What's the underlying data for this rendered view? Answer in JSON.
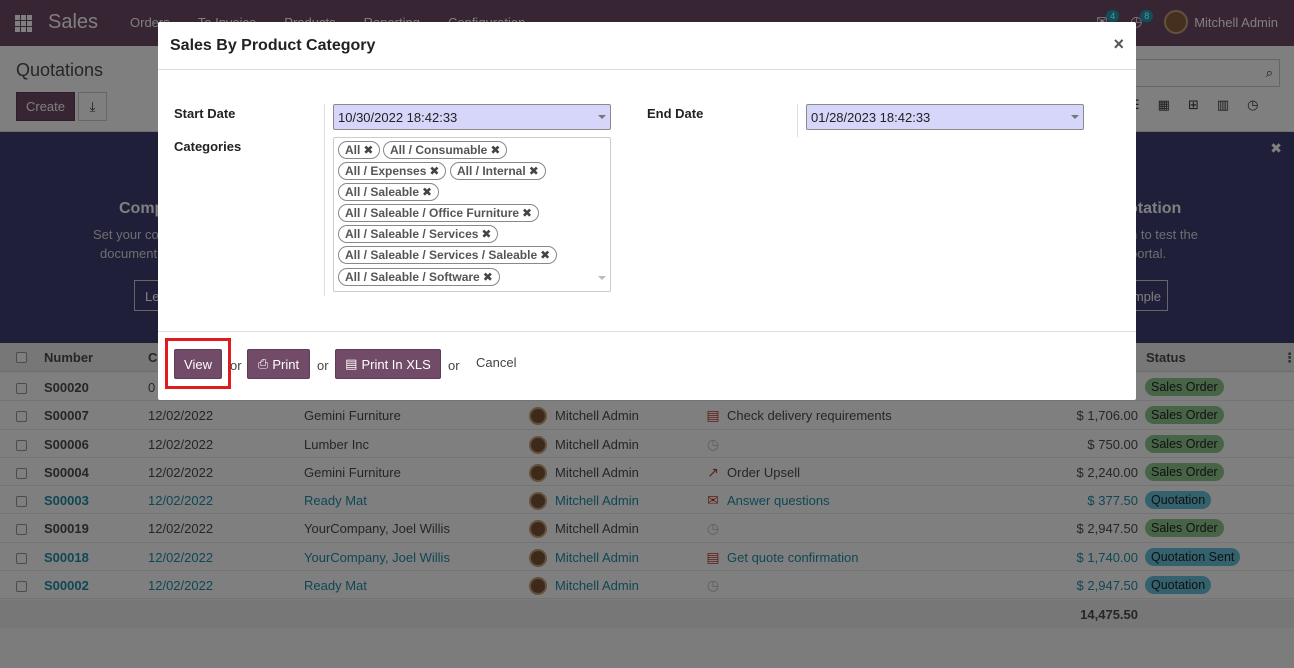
{
  "navbar": {
    "brand": "Sales",
    "menu": [
      "Orders",
      "To Invoice",
      "Products",
      "Reporting",
      "Configuration"
    ],
    "messages_count": "4",
    "activities_count": "8",
    "user_name": "Mitchell Admin"
  },
  "control_panel": {
    "title": "Quotations",
    "create_label": "Create"
  },
  "banner": {
    "left_title": "Comp",
    "left_text1": "Set your co",
    "left_text2": "document",
    "left_button": "Le",
    "right_title": "otation",
    "right_text1": "n to test the",
    "right_text2": "portal.",
    "right_button": "mple"
  },
  "list": {
    "headers": {
      "number": "Number",
      "col2": "C",
      "status": "Status"
    },
    "rows": [
      {
        "number": "S00020",
        "date": "0",
        "customer": "",
        "salesperson": "",
        "activity": "",
        "activity_icon": "",
        "total": "",
        "status": "Sales Order",
        "status_type": "order",
        "highlight": false
      },
      {
        "number": "S00007",
        "date": "12/02/2022",
        "customer": "Gemini Furniture",
        "salesperson": "Mitchell Admin",
        "activity": "Check delivery requirements",
        "activity_icon": "list-icon",
        "total": "$ 1,706.00",
        "status": "Sales Order",
        "status_type": "order",
        "highlight": false
      },
      {
        "number": "S00006",
        "date": "12/02/2022",
        "customer": "Lumber Inc",
        "salesperson": "Mitchell Admin",
        "activity": "",
        "activity_icon": "clock-icon",
        "total": "$ 750.00",
        "status": "Sales Order",
        "status_type": "order",
        "highlight": false
      },
      {
        "number": "S00004",
        "date": "12/02/2022",
        "customer": "Gemini Furniture",
        "salesperson": "Mitchell Admin",
        "activity": "Order Upsell",
        "activity_icon": "chart-line-icon",
        "total": "$ 2,240.00",
        "status": "Sales Order",
        "status_type": "order",
        "highlight": false
      },
      {
        "number": "S00003",
        "date": "12/02/2022",
        "customer": "Ready Mat",
        "salesperson": "Mitchell Admin",
        "activity": "Answer questions",
        "activity_icon": "envelope-icon",
        "total": "$ 377.50",
        "status": "Quotation",
        "status_type": "quote",
        "highlight": true
      },
      {
        "number": "S00019",
        "date": "12/02/2022",
        "customer": "YourCompany, Joel Willis",
        "salesperson": "Mitchell Admin",
        "activity": "",
        "activity_icon": "clock-icon",
        "total": "$ 2,947.50",
        "status": "Sales Order",
        "status_type": "order",
        "highlight": false
      },
      {
        "number": "S00018",
        "date": "12/02/2022",
        "customer": "YourCompany, Joel Willis",
        "salesperson": "Mitchell Admin",
        "activity": "Get quote confirmation",
        "activity_icon": "list-icon",
        "total": "$ 1,740.00",
        "status": "Quotation Sent",
        "status_type": "quote",
        "highlight": true
      },
      {
        "number": "S00002",
        "date": "12/02/2022",
        "customer": "Ready Mat",
        "salesperson": "Mitchell Admin",
        "activity": "",
        "activity_icon": "clock-icon",
        "total": "$ 2,947.50",
        "status": "Quotation",
        "status_type": "quote",
        "highlight": true
      }
    ],
    "footer_total": "14,475.50"
  },
  "modal": {
    "title": "Sales By Product Category",
    "close": "×",
    "start_date_label": "Start Date",
    "start_date_value": "10/30/2022 18:42:33",
    "end_date_label": "End Date",
    "end_date_value": "01/28/2023 18:42:33",
    "categories_label": "Categories",
    "categories": [
      "All",
      "All / Consumable",
      "All / Expenses",
      "All / Internal",
      "All / Saleable",
      "All / Saleable / Office Furniture",
      "All / Saleable / Services",
      "All / Saleable / Services / Saleable",
      "All / Saleable / Software"
    ],
    "buttons": {
      "view": "View",
      "print": "Print",
      "print_xls": "Print In XLS",
      "or": "or",
      "cancel": "Cancel"
    }
  },
  "colors": {
    "brand": "#714b67",
    "date_input_bg": "#d6d6fb",
    "highlight_box": "#e01b1b",
    "status_order": "#8fc98f",
    "status_quote": "#66c3da"
  }
}
